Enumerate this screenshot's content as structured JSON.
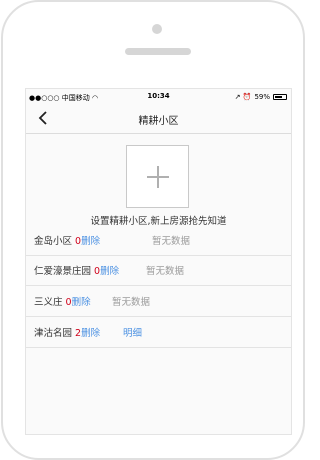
{
  "status_bar": {
    "carrier": "●●○○○ 中国移动 ",
    "wifi_icon": "wifi-icon",
    "time": "10:34",
    "right_icons": "↗ ⏰ ",
    "battery": "59%"
  },
  "nav": {
    "back_icon": "chevron-left-icon",
    "title": "精耕小区"
  },
  "add": {
    "icon": "plus-icon",
    "hint": "设置精耕小区,新上房源抢先知道"
  },
  "communities": [
    {
      "name": "金岛小区 ",
      "count": "0",
      "delete": "删除",
      "status": "暂无数据"
    },
    {
      "name": "仁爱濠景庄园 ",
      "count": "0",
      "delete": "删除",
      "status": "暂无数据"
    },
    {
      "name": "三义庄 ",
      "count": "0",
      "delete": "删除",
      "status": "暂无数据"
    },
    {
      "name": "津沽名园 ",
      "count": "2",
      "delete": "删除",
      "status": "明细"
    }
  ],
  "colors": {
    "count": "#d0021b",
    "link": "#4a90e2",
    "muted": "#9b9b9b"
  }
}
